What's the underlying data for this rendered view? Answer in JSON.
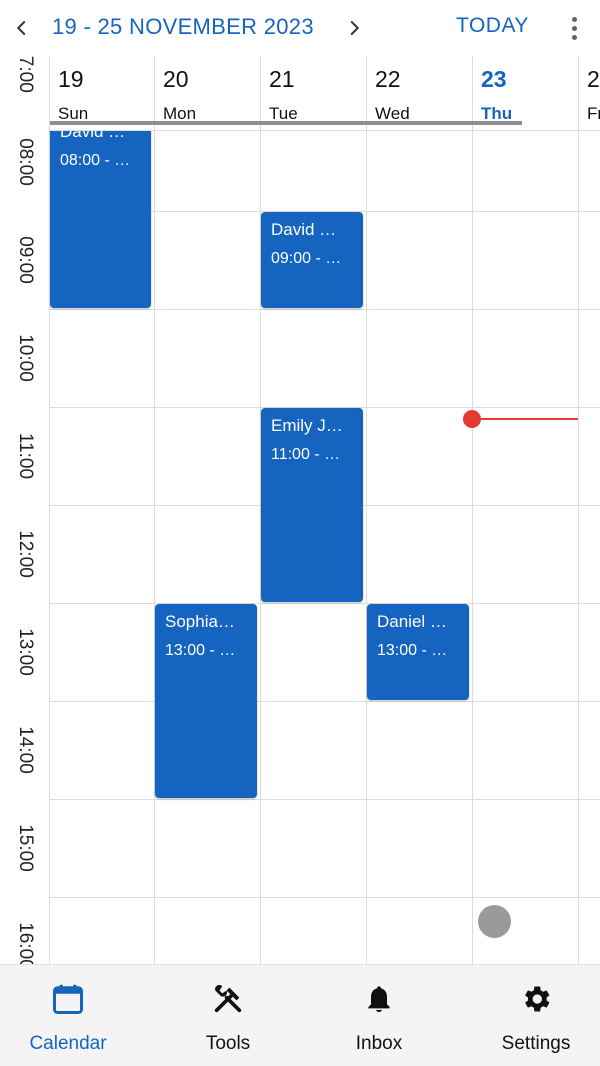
{
  "header": {
    "date_range": "19 - 25 NOVEMBER 2023",
    "today_label": "TODAY",
    "prev_icon": "chevron-left-icon",
    "next_icon": "chevron-right-icon",
    "more_icon": "more-vertical-icon"
  },
  "hours": [
    "07:00",
    "08:00",
    "09:00",
    "10:00",
    "11:00",
    "12:00",
    "13:00",
    "14:00",
    "15:00",
    "16:00"
  ],
  "days": [
    {
      "num": "19",
      "name": "Sun",
      "today": false
    },
    {
      "num": "20",
      "name": "Mon",
      "today": false
    },
    {
      "num": "21",
      "name": "Tue",
      "today": false
    },
    {
      "num": "22",
      "name": "Wed",
      "today": false
    },
    {
      "num": "23",
      "name": "Thu",
      "today": true
    },
    {
      "num": "2",
      "name": "Fr",
      "today": false
    }
  ],
  "events": [
    {
      "title": "David …",
      "time": "08:00 - …"
    },
    {
      "title": "David …",
      "time": "09:00 - …"
    },
    {
      "title": "Emily J…",
      "time": "11:00 - …"
    },
    {
      "title": "Sophia…",
      "time": "13:00 - …"
    },
    {
      "title": "Daniel …",
      "time": "13:00 - …"
    }
  ],
  "bottom_nav": [
    {
      "label": "Calendar",
      "icon": "calendar-icon",
      "active": true
    },
    {
      "label": "Tools",
      "icon": "tools-icon",
      "active": false
    },
    {
      "label": "Inbox",
      "icon": "bell-icon",
      "active": false
    },
    {
      "label": "Settings",
      "icon": "gear-icon",
      "active": false
    }
  ],
  "colors": {
    "accent": "#1565c0",
    "event": "#1565c0",
    "now_indicator": "#e53935",
    "grid": "#dcdcdc"
  }
}
